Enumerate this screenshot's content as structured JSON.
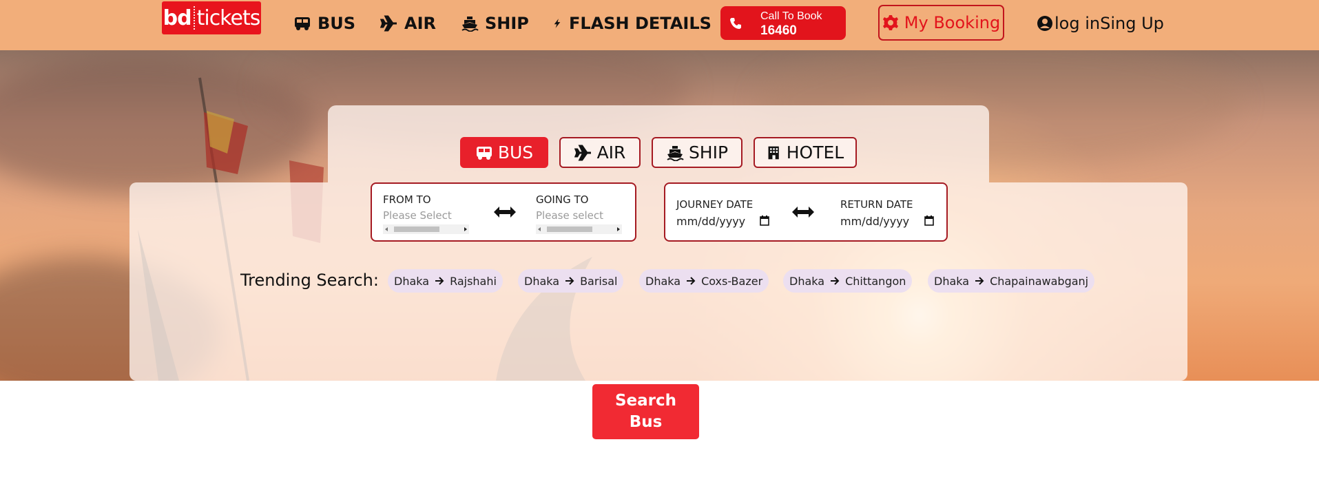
{
  "logo": {
    "part1": "bd",
    "part2": "tickets"
  },
  "nav": {
    "links": [
      {
        "label": "BUS",
        "icon": "bus-icon"
      },
      {
        "label": "AIR",
        "icon": "plane-icon"
      },
      {
        "label": "SHIP",
        "icon": "ship-icon"
      },
      {
        "label": "FLASH DETAILS",
        "icon": "bolt-icon"
      }
    ],
    "call": {
      "line1": "Call To Book",
      "line2": "16460",
      "icon": "phone-icon"
    },
    "my_booking": {
      "label": "My Booking",
      "icon": "gear-icon"
    },
    "login": {
      "label": "log inSing Up",
      "icon": "user-circle-icon"
    }
  },
  "tabs": [
    {
      "label": "BUS",
      "icon": "bus-icon",
      "active": true
    },
    {
      "label": "AIR",
      "icon": "plane-icon",
      "active": false
    },
    {
      "label": "SHIP",
      "icon": "ship-icon",
      "active": false
    },
    {
      "label": "HOTEL",
      "icon": "building-icon",
      "active": false
    }
  ],
  "route": {
    "from_label": "FROM TO",
    "from_placeholder": "Please Select",
    "to_label": "GOING TO",
    "to_placeholder": "Please select"
  },
  "dates": {
    "journey_label": "JOURNEY DATE",
    "journey_placeholder": "mm/dd/yyyy",
    "return_label": "RETURN DATE",
    "return_placeholder": "mm/dd/yyyy"
  },
  "trending": {
    "label": "Trending Search:",
    "items": [
      {
        "from": "Dhaka",
        "to": "Rajshahi"
      },
      {
        "from": "Dhaka",
        "to": "Barisal"
      },
      {
        "from": "Dhaka",
        "to": "Coxs-Bazer"
      },
      {
        "from": "Dhaka",
        "to": "Chittangon"
      },
      {
        "from": "Dhaka",
        "to": "Chapainawabganj"
      }
    ]
  },
  "search_button": {
    "line1": "Search",
    "line2": "Bus"
  },
  "colors": {
    "nav_bg": "#f2ae7a",
    "brand_red": "#e2141c",
    "border_red": "#a51a22",
    "search_red": "#f12a33",
    "chip_bg": "#ecdff0"
  }
}
